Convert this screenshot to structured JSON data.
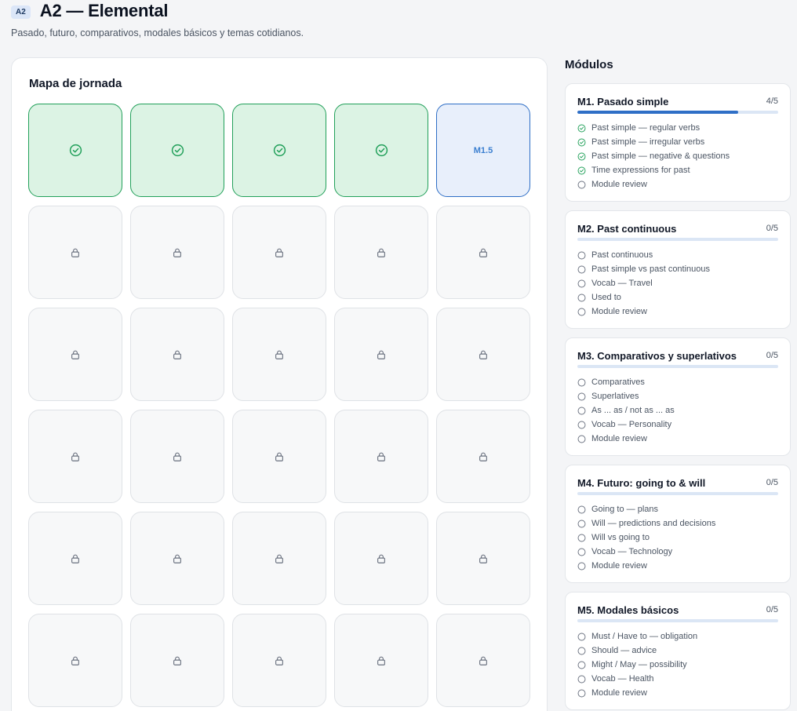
{
  "header": {
    "badge": "A2",
    "title": "A2 — Elemental",
    "subtitle": "Pasado, futuro, comparativos, modales básicos y temas cotidianos."
  },
  "map": {
    "title": "Mapa de jornada",
    "tiles": [
      {
        "state": "done",
        "icon": "check-circle-icon"
      },
      {
        "state": "done",
        "icon": "check-circle-icon"
      },
      {
        "state": "done",
        "icon": "check-circle-icon"
      },
      {
        "state": "done",
        "icon": "check-circle-icon"
      },
      {
        "state": "current",
        "label": "M1.5"
      },
      {
        "state": "locked",
        "icon": "lock-icon"
      },
      {
        "state": "locked",
        "icon": "lock-icon"
      },
      {
        "state": "locked",
        "icon": "lock-icon"
      },
      {
        "state": "locked",
        "icon": "lock-icon"
      },
      {
        "state": "locked",
        "icon": "lock-icon"
      },
      {
        "state": "locked",
        "icon": "lock-icon"
      },
      {
        "state": "locked",
        "icon": "lock-icon"
      },
      {
        "state": "locked",
        "icon": "lock-icon"
      },
      {
        "state": "locked",
        "icon": "lock-icon"
      },
      {
        "state": "locked",
        "icon": "lock-icon"
      },
      {
        "state": "locked",
        "icon": "lock-icon"
      },
      {
        "state": "locked",
        "icon": "lock-icon"
      },
      {
        "state": "locked",
        "icon": "lock-icon"
      },
      {
        "state": "locked",
        "icon": "lock-icon"
      },
      {
        "state": "locked",
        "icon": "lock-icon"
      },
      {
        "state": "locked",
        "icon": "lock-icon"
      },
      {
        "state": "locked",
        "icon": "lock-icon"
      },
      {
        "state": "locked",
        "icon": "lock-icon"
      },
      {
        "state": "locked",
        "icon": "lock-icon"
      },
      {
        "state": "locked",
        "icon": "lock-icon"
      },
      {
        "state": "locked",
        "icon": "lock-icon"
      },
      {
        "state": "locked",
        "icon": "lock-icon"
      },
      {
        "state": "locked",
        "icon": "lock-icon"
      },
      {
        "state": "locked",
        "icon": "lock-icon"
      },
      {
        "state": "locked",
        "icon": "lock-icon"
      }
    ]
  },
  "modules_title": "Módulos",
  "modules": [
    {
      "name": "M1. Pasado simple",
      "count": "4/5",
      "progress": 0.8,
      "lessons": [
        {
          "label": "Past simple — regular verbs",
          "done": true
        },
        {
          "label": "Past simple — irregular verbs",
          "done": true
        },
        {
          "label": "Past simple — negative & questions",
          "done": true
        },
        {
          "label": "Time expressions for past",
          "done": true
        },
        {
          "label": "Module review",
          "done": false
        }
      ]
    },
    {
      "name": "M2. Past continuous",
      "count": "0/5",
      "progress": 0,
      "lessons": [
        {
          "label": "Past continuous",
          "done": false
        },
        {
          "label": "Past simple vs past continuous",
          "done": false
        },
        {
          "label": "Vocab — Travel",
          "done": false
        },
        {
          "label": "Used to",
          "done": false
        },
        {
          "label": "Module review",
          "done": false
        }
      ]
    },
    {
      "name": "M3. Comparativos y superlativos",
      "count": "0/5",
      "progress": 0,
      "lessons": [
        {
          "label": "Comparatives",
          "done": false
        },
        {
          "label": "Superlatives",
          "done": false
        },
        {
          "label": "As ... as / not as ... as",
          "done": false
        },
        {
          "label": "Vocab — Personality",
          "done": false
        },
        {
          "label": "Module review",
          "done": false
        }
      ]
    },
    {
      "name": "M4. Futuro: going to & will",
      "count": "0/5",
      "progress": 0,
      "lessons": [
        {
          "label": "Going to — plans",
          "done": false
        },
        {
          "label": "Will — predictions and decisions",
          "done": false
        },
        {
          "label": "Will vs going to",
          "done": false
        },
        {
          "label": "Vocab — Technology",
          "done": false
        },
        {
          "label": "Module review",
          "done": false
        }
      ]
    },
    {
      "name": "M5. Modales básicos",
      "count": "0/5",
      "progress": 0,
      "lessons": [
        {
          "label": "Must / Have to — obligation",
          "done": false
        },
        {
          "label": "Should — advice",
          "done": false
        },
        {
          "label": "Might / May — possibility",
          "done": false
        },
        {
          "label": "Vocab — Health",
          "done": false
        },
        {
          "label": "Module review",
          "done": false
        }
      ]
    }
  ],
  "colors": {
    "done": "#22a05a",
    "current": "#2f6fc6",
    "locked": "#6b7280",
    "pending": "#6b7280"
  }
}
